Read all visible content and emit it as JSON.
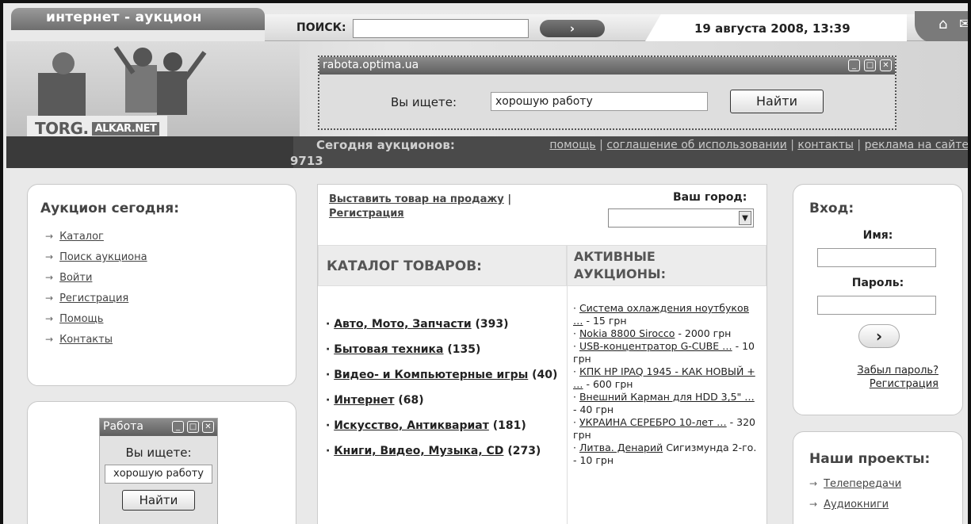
{
  "header": {
    "site_tab": "интернет - аукцион",
    "search_label": "ПОИСК:",
    "search_value": "",
    "search_go": "›",
    "date": "19 августа 2008, 13:39",
    "home_icon": "⌂",
    "mail_icon": "✉"
  },
  "banner": {
    "brand_main": "TORG.",
    "brand_sub": "ALKAR.NET"
  },
  "popup": {
    "title": "rabota.optima.ua",
    "label": "Вы ищете:",
    "input_value": "хорошую работу",
    "button": "Найти"
  },
  "statbar": {
    "today_label": "Сегодня аукционов:",
    "today_count": "9713",
    "links": [
      "помощь",
      "соглашение об использовании",
      "контакты",
      "реклама на сайте"
    ],
    "sep": "|"
  },
  "left": {
    "title": "Аукцион сегодня:",
    "items": [
      "Каталог",
      "Поиск аукциона",
      "Войти",
      "Регистрация",
      "Помощь",
      "Контакты"
    ],
    "arrow": "→"
  },
  "widget": {
    "title": "Работа",
    "label": "Вы ищете:",
    "input_value": "хорошую работу",
    "button": "Найти"
  },
  "center": {
    "sell_link": "Выставить товар на продажу",
    "sep": "|",
    "register_link": "Регистрация",
    "city_label": "Ваш город:",
    "city_value": "",
    "catalog_title": "КАТАЛОГ ТОВАРОВ:",
    "active_title": "АКТИВНЫЕ АУКЦИОНЫ:",
    "categories": [
      {
        "name": "Авто, Мото, Запчасти",
        "count": "(393)"
      },
      {
        "name": "Бытовая техника",
        "count": "(135)"
      },
      {
        "name": "Видео- и Компьютерные игры",
        "count": "(40)"
      },
      {
        "name": "Интернет",
        "count": "(68)"
      },
      {
        "name": "Искусство, Антиквариат",
        "count": "(181)"
      },
      {
        "name": "Книги, Видео, Музыка, CD",
        "count": "(273)"
      }
    ],
    "active": [
      {
        "name": "Система охлаждения ноутбуков …",
        "price": "- 15 грн"
      },
      {
        "name": "Nokia 8800 Sirocco",
        "price": "- 2000 грн"
      },
      {
        "name": "USB-концентратор G-CUBE …",
        "price": "- 10 грн"
      },
      {
        "name": "КПК HP IPAQ 1945 - КАК НОВЫЙ + …",
        "price": "- 600 грн"
      },
      {
        "name": "Внешний Карман для HDD 3,5\" …",
        "price": "- 40 грн"
      },
      {
        "name": "УКРАИНА СЕРЕБРО 10-лет …",
        "price": "- 320 грн"
      },
      {
        "name": "Литва. Денарий",
        "price": "Сигизмунда 2-го. - 10 грн"
      }
    ]
  },
  "login": {
    "title": "Вход:",
    "name_label": "Имя:",
    "password_label": "Пароль:",
    "submit": "›",
    "forgot": "Забыл пароль?",
    "register": "Регистрация"
  },
  "projects": {
    "title": "Наши проекты:",
    "items": [
      "Телепередачи",
      "Аудиокниги"
    ]
  }
}
